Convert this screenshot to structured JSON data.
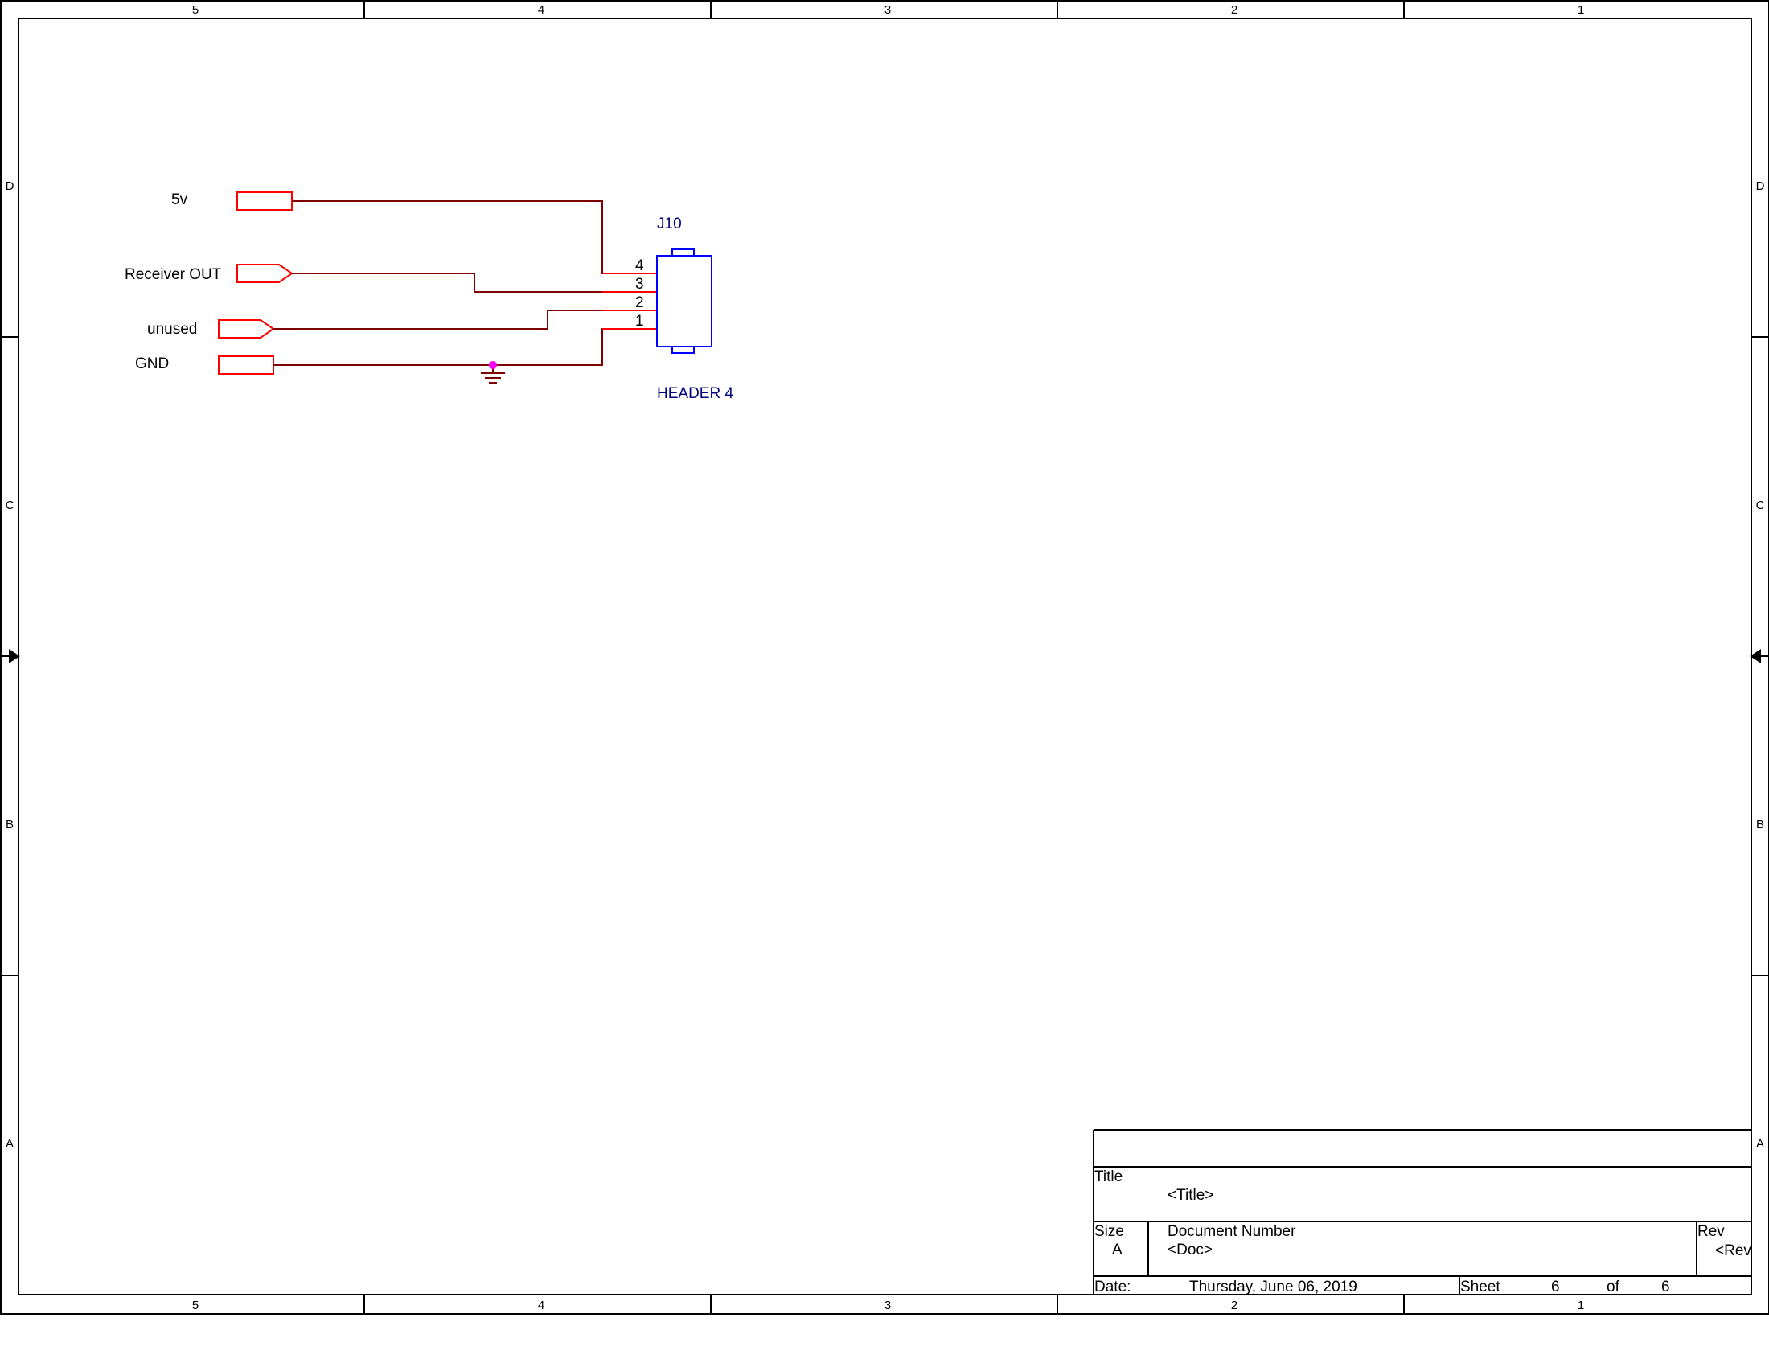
{
  "frame": {
    "columns": [
      "5",
      "4",
      "3",
      "2",
      "1"
    ],
    "rows": [
      "D",
      "C",
      "B",
      "A"
    ]
  },
  "schematic": {
    "nets": [
      {
        "label": "5v"
      },
      {
        "label": "Receiver OUT"
      },
      {
        "label": "unused"
      },
      {
        "label": "GND"
      }
    ],
    "connector": {
      "refdes": "J10",
      "value": "HEADER 4",
      "pins": [
        "4",
        "3",
        "2",
        "1"
      ]
    }
  },
  "title_block": {
    "title_label": "Title",
    "title_value": "<Title>",
    "size_label": "Size",
    "size_value": "A",
    "docnum_label": "Document Number",
    "docnum_value": "<Doc>",
    "rev_label": "Rev",
    "rev_value": "<RevCode>",
    "date_label": "Date:",
    "date_value": "Thursday, June 06, 2019",
    "sheet_label": "Sheet",
    "sheet_value": "6",
    "of_label": "of",
    "of_value": "6"
  },
  "colors": {
    "wire": "#800000",
    "port": "#ff0000",
    "part": "#0000ff",
    "junction": "#ff00ff"
  }
}
